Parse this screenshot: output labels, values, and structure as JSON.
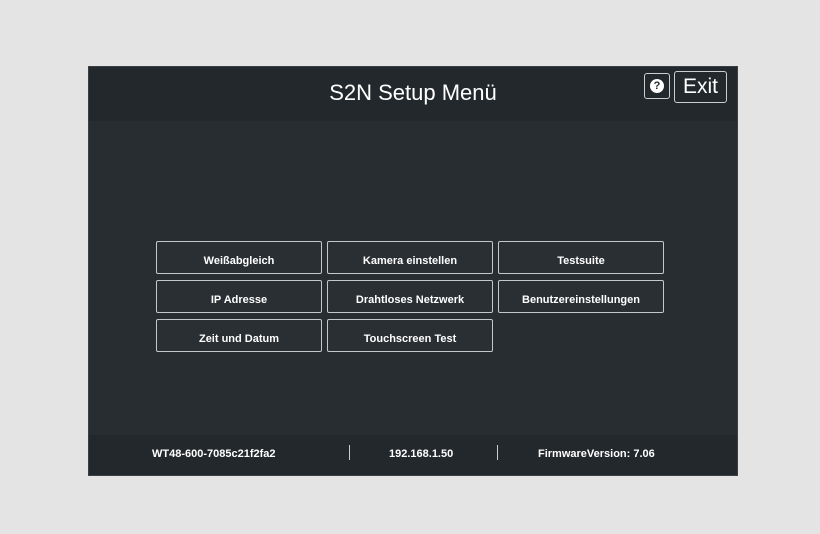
{
  "header": {
    "title": "S2N Setup Menü",
    "help_icon_glyph": "?",
    "exit_label": "Exit"
  },
  "menu": {
    "buttons": [
      "Weißabgleich",
      "Kamera einstellen",
      "Testsuite",
      "IP Adresse",
      "Drahtloses Netzwerk",
      "Benutzereinstellungen",
      "Zeit und Datum",
      "Touchscreen Test"
    ]
  },
  "footer": {
    "device_id": "WT48-600-7085c21f2fa2",
    "ip_address": "192.168.1.50",
    "firmware": "FirmwareVersion: 7.06"
  },
  "colors": {
    "page_background": "#e4e4e4",
    "screen_background": "#282d31",
    "bar_background": "#23282c",
    "text": "#ffffff",
    "button_border": "#c3c8cd"
  }
}
